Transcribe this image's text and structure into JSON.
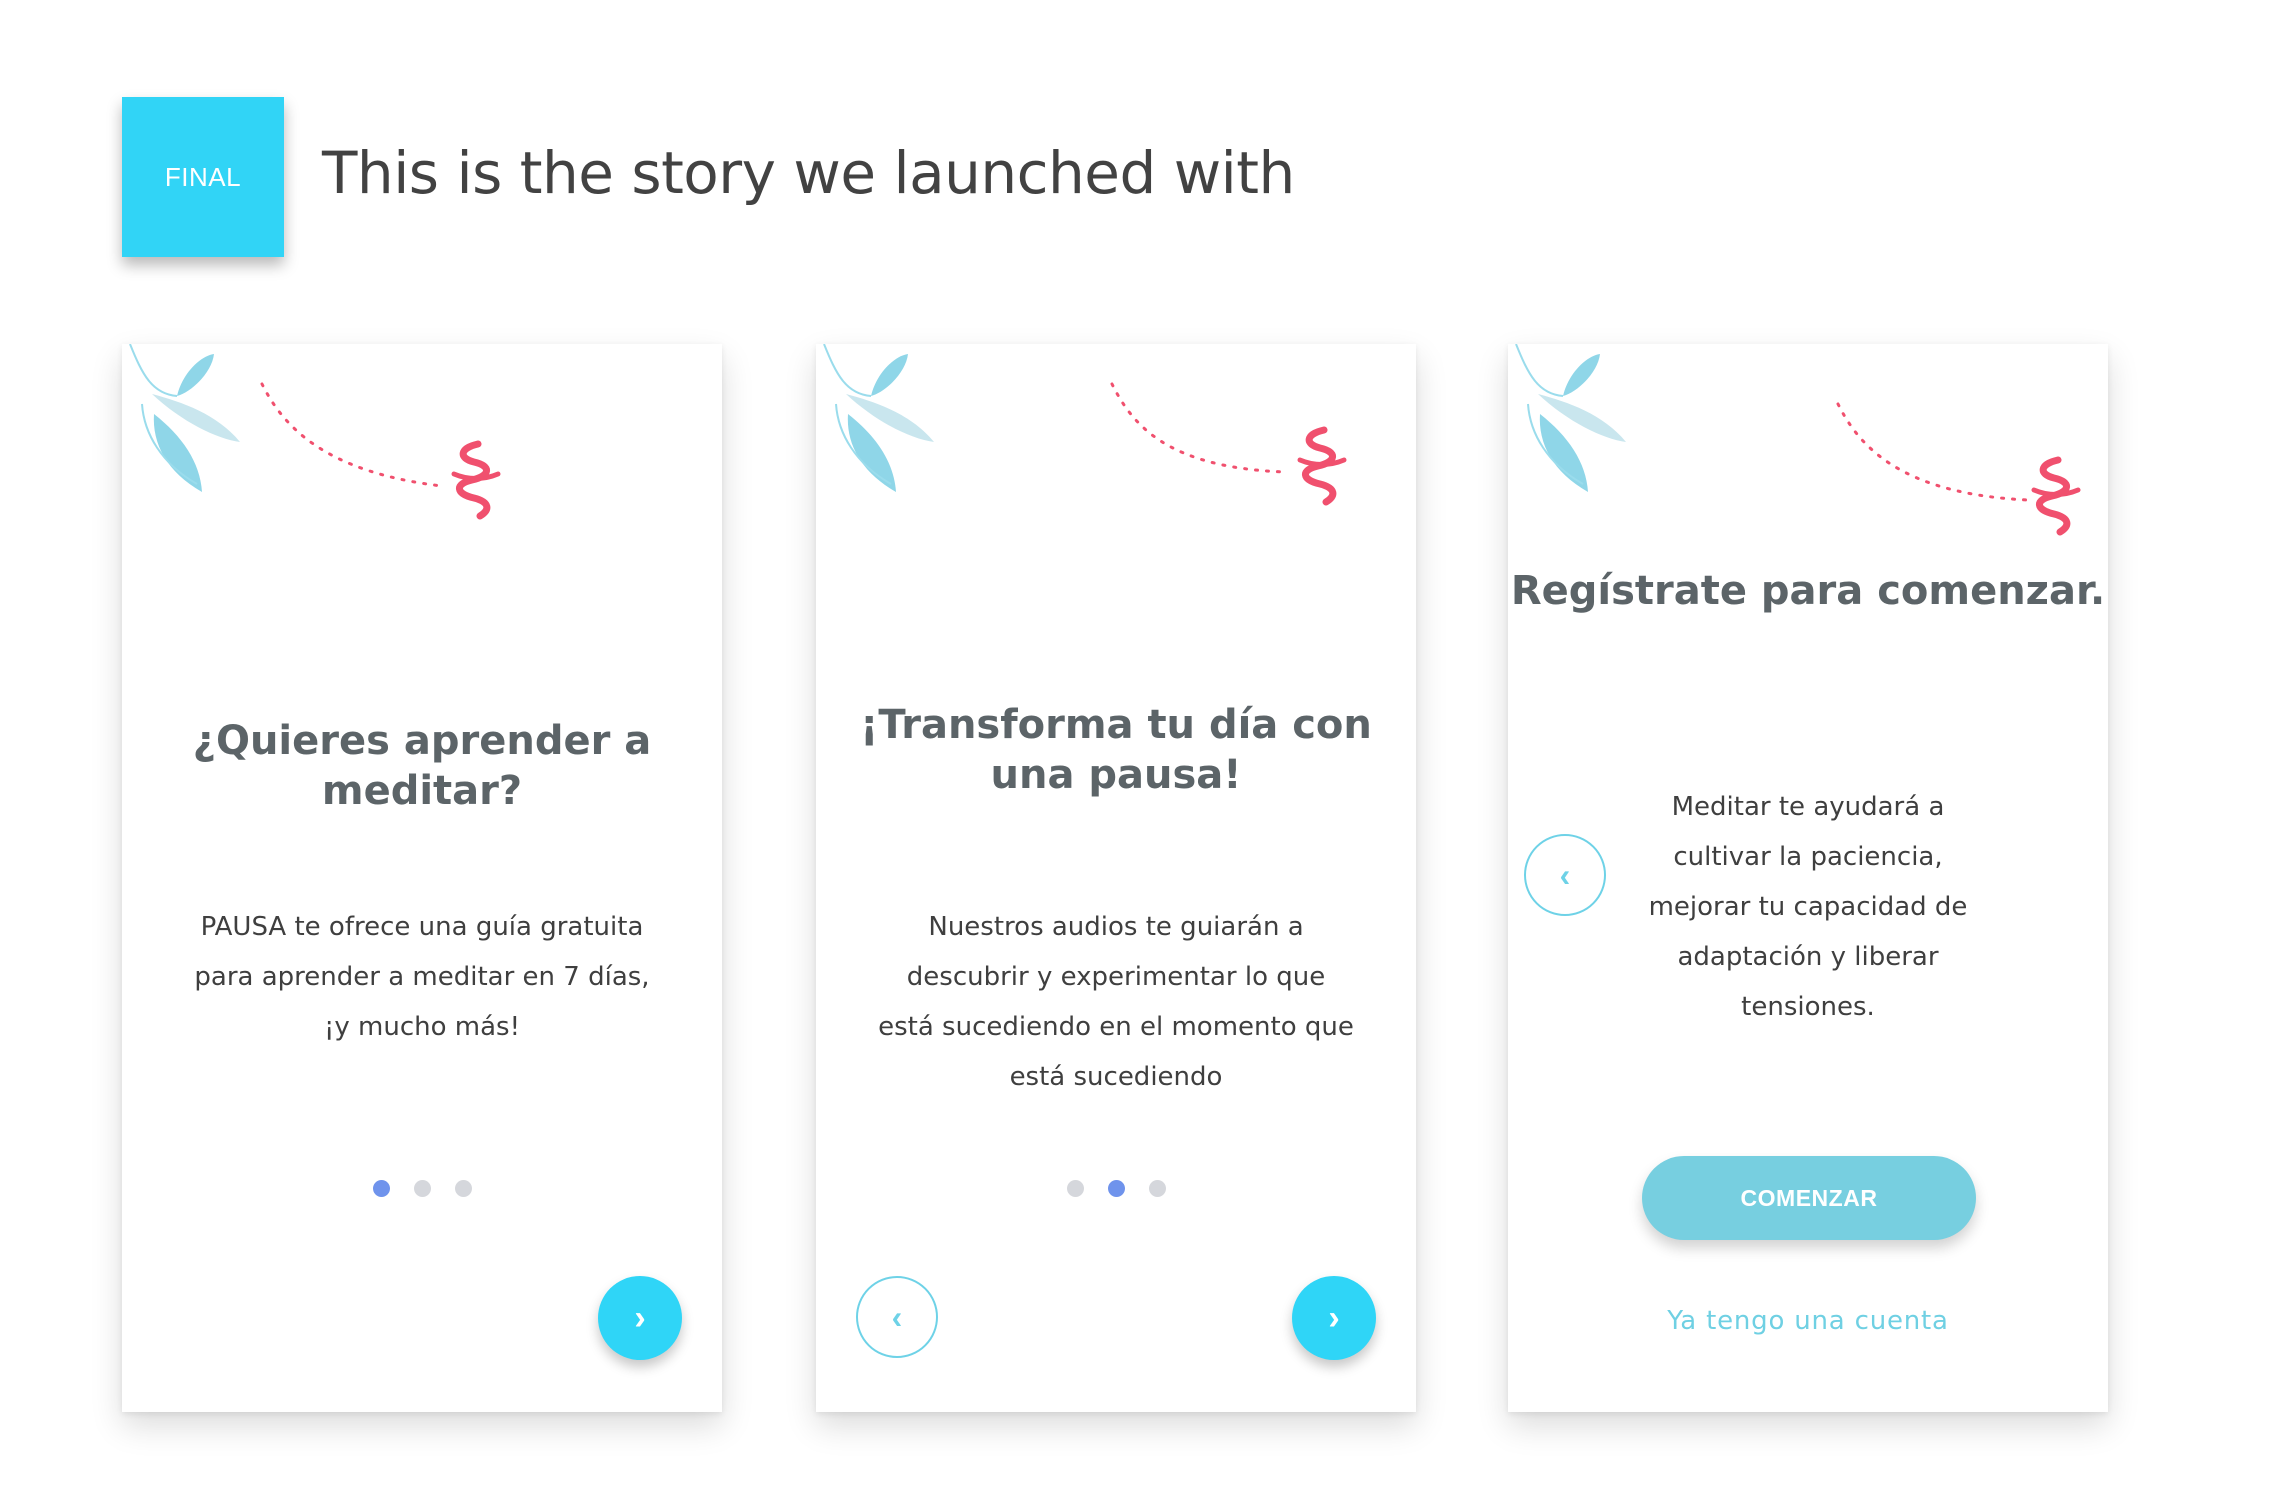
{
  "header": {
    "badge_label": "FINAL",
    "title": "This is the story we launched with"
  },
  "cards": [
    {
      "title": "¿Quieres aprender a meditar?",
      "body": "PAUSA te ofrece una guía gratuita para aprender a meditar en 7 días, ¡y mucho más!",
      "active_dot": 1,
      "next_icon": "chevron-right-icon"
    },
    {
      "title": "¡Transforma tu día con una pausa!",
      "body": "Nuestros audios te guiarán a descubrir y experimentar lo que está sucediendo en el momento que está sucediendo",
      "active_dot": 2,
      "prev_icon": "chevron-left-icon",
      "next_icon": "chevron-right-icon"
    },
    {
      "title": "Regístrate para comenzar.",
      "body": "Meditar te ayudará a cultivar la paciencia, mejorar tu capacidad de adaptación y liberar tensiones.",
      "prev_icon": "chevron-left-icon",
      "cta_label": "COMENZAR",
      "link_label": "Ya tengo una cuenta"
    }
  ],
  "icons": {
    "chevron_right": "›",
    "chevron_left": "‹"
  },
  "colors": {
    "accent": "#31d4f6",
    "button_secondary": "#77cfe0",
    "title_text": "#5c6468",
    "dot_active": "#6f93ec",
    "dot_inactive": "#d5d7dc",
    "logo_pink": "#f0506e",
    "leaf_blue": "#7fd3e6"
  }
}
